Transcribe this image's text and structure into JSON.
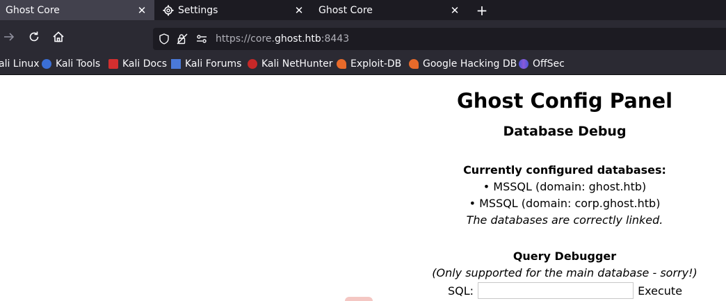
{
  "tabs": [
    {
      "title": "Ghost Core",
      "active": true
    },
    {
      "title": "Settings",
      "active": false
    },
    {
      "title": "Ghost Core",
      "active": false
    }
  ],
  "toolbar": {
    "url_prefix": "https://core.",
    "url_host": "ghost.htb",
    "url_suffix": ":8443"
  },
  "bookmarks": [
    {
      "label": "ali Linux"
    },
    {
      "label": "Kali Tools"
    },
    {
      "label": "Kali Docs"
    },
    {
      "label": "Kali Forums"
    },
    {
      "label": "Kali NetHunter"
    },
    {
      "label": "Exploit-DB"
    },
    {
      "label": "Google Hacking DB"
    },
    {
      "label": "OffSec"
    }
  ],
  "page": {
    "title": "Ghost Config Panel",
    "subtitle": "Database Debug",
    "db_heading": "Currently configured databases:",
    "databases": [
      "• MSSQL (domain: ghost.htb)",
      "• MSSQL (domain: corp.ghost.htb)"
    ],
    "db_note": "The databases are correctly linked.",
    "query_heading": "Query Debugger",
    "query_note": "(Only supported for the main database - sorry!)",
    "sql_label": "SQL:",
    "sql_value": "",
    "execute_label": "Execute"
  }
}
